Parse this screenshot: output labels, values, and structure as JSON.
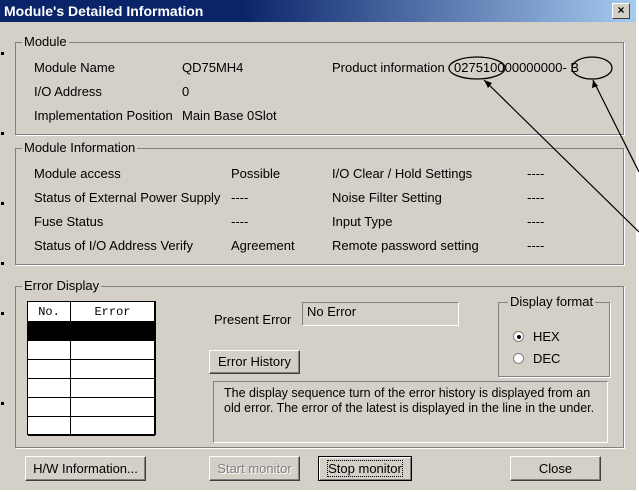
{
  "window": {
    "title": "Module's Detailed Information",
    "close_glyph": "×"
  },
  "module": {
    "legend": "Module",
    "name_label": "Module Name",
    "name_value": "QD75MH4",
    "io_label": "I/O Address",
    "io_value": "0",
    "position_label": "Implementation Position",
    "position_value": "Main Base  0Slot",
    "product_label": "Product information",
    "product_value_a": "02751",
    "product_value_b": "0000000000",
    "product_value_c": "- B"
  },
  "module_info": {
    "legend": "Module Information",
    "rows": [
      {
        "label": "Module access",
        "value": "Possible",
        "label2": "I/O Clear / Hold Settings",
        "value2": "----"
      },
      {
        "label": "Status of External Power Supply",
        "value": "----",
        "label2": "Noise Filter Setting",
        "value2": "----"
      },
      {
        "label": "Fuse Status",
        "value": "----",
        "label2": "Input Type",
        "value2": "----"
      },
      {
        "label": "Status of I/O Address Verify",
        "value": "Agreement",
        "label2": "Remote password setting",
        "value2": "----"
      }
    ]
  },
  "error_display": {
    "legend": "Error Display",
    "col_no": "No.",
    "col_error": "Error",
    "present_label": "Present Error",
    "present_value": "No Error",
    "history_button": "Error History",
    "note": "The display sequence turn of the error history is displayed from an old error. The error of the latest is displayed in the line in the under."
  },
  "display_format": {
    "legend": "Display format",
    "options": [
      "HEX",
      "DEC"
    ],
    "selected": "HEX"
  },
  "buttons": {
    "hw_info": "H/W Information...",
    "start_monitor": "Start monitor",
    "stop_monitor": "Stop monitor",
    "close": "Close"
  },
  "colors": {
    "title_bar": "#0a246a",
    "dialog_face": "#d4d0c8"
  }
}
